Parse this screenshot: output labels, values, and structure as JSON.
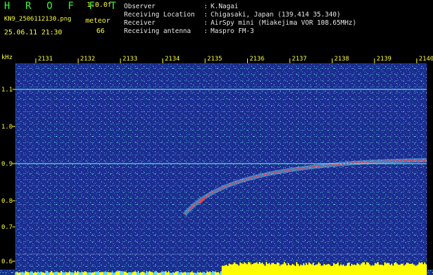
{
  "header": {
    "title": "H R O F F T",
    "version": "1.0.0f",
    "filename": "KN9_2506112130.png",
    "meteor_label": "meteor",
    "meteor_count": "66",
    "datetime": "25.06.11 21:30",
    "info": [
      {
        "key": "Observer",
        "value": "K.Nagai"
      },
      {
        "key": "Receiving Location",
        "value": "Chigasaki, Japan (139.414 35.340)"
      },
      {
        "key": "Receiver",
        "value": "AirSpy mini (Miakejima VOR 108.65MHz)"
      },
      {
        "key": "Receiving antenna",
        "value": "Maspro FM-3"
      }
    ]
  },
  "spectrogram": {
    "y_unit": "kHz",
    "y_ticks": [
      "1.1",
      "1.0",
      "0.9",
      "0.8",
      "0.7",
      "0.6"
    ],
    "time_ticks": [
      "2131",
      "2132",
      "2133",
      "2134",
      "2135",
      "2136",
      "2137",
      "2138",
      "2139",
      "2140"
    ],
    "colors": {
      "background": "#1a2a8c",
      "label": "#ffff33",
      "trace": "#ff3030",
      "carrier": "#5fe0d0",
      "noise_bar": "#ffff00"
    }
  }
}
